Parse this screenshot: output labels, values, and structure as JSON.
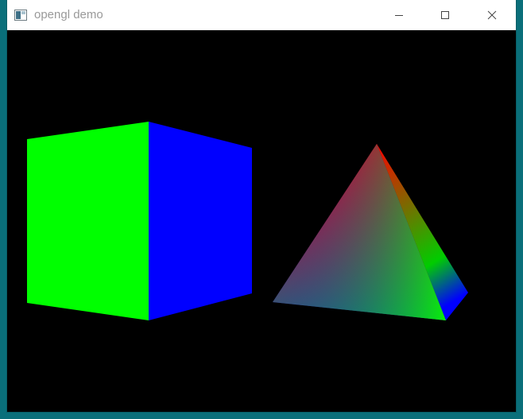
{
  "window": {
    "title": "opengl demo",
    "icon": "application-window-icon"
  },
  "titlebar_buttons": {
    "minimize": "minimize-icon",
    "maximize": "maximize-icon",
    "close": "close-icon"
  },
  "colors": {
    "viewport_background": "#000000",
    "cube_front_face": "#00ff00",
    "cube_side_face": "#0000ff",
    "pyramid_apex": "#ff0000",
    "pyramid_left_corner": "#0000ff",
    "pyramid_front_corner": "#00ff00",
    "pyramid_right_corner": "#0000ff",
    "desktop_background": "#0a6f7a"
  }
}
